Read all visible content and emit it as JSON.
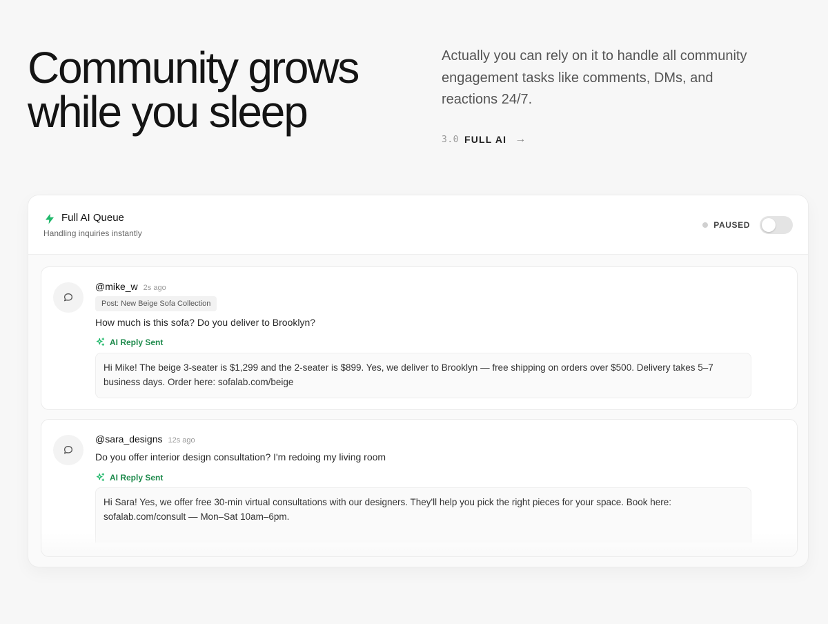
{
  "hero": {
    "title_line1": "Community grows",
    "title_line2": "while you sleep",
    "description": "Actually you can rely on it to handle all community engagement tasks like comments, DMs, and reactions 24/7.",
    "version_number": "3.0",
    "version_label": "FULL AI",
    "arrow": "→"
  },
  "queue": {
    "title": "Full AI Queue",
    "subtitle": "Handling inquiries instantly",
    "status_label": "PAUSED",
    "toggle_on": false,
    "accent_color": "#1fb86a"
  },
  "items": [
    {
      "handle": "@mike_w",
      "time": "2s ago",
      "post": "Post: New Beige Sofa Collection",
      "question": "How much is this sofa? Do you deliver to Brooklyn?",
      "reply_status": "AI Reply Sent",
      "reply": "Hi Mike! The beige 3-seater is $1,299 and the 2-seater is $899. Yes, we deliver to Brooklyn — free shipping on orders over $500. Delivery takes 5–7 business days. Order here: sofalab.com/beige"
    },
    {
      "handle": "@sara_designs",
      "time": "12s ago",
      "question": "Do you offer interior design consultation? I'm redoing my living room",
      "reply_status": "AI Reply Sent",
      "reply": "Hi Sara! Yes, we offer free 30-min virtual consultations with our designers. They'll help you pick the right pieces for your space. Book here: sofalab.com/consult — Mon–Sat 10am–6pm."
    }
  ],
  "icons": {
    "bolt": "bolt-icon",
    "chat": "chat-bubble-icon",
    "sparkle": "sparkle-icon",
    "arrow": "arrow-right-icon"
  }
}
